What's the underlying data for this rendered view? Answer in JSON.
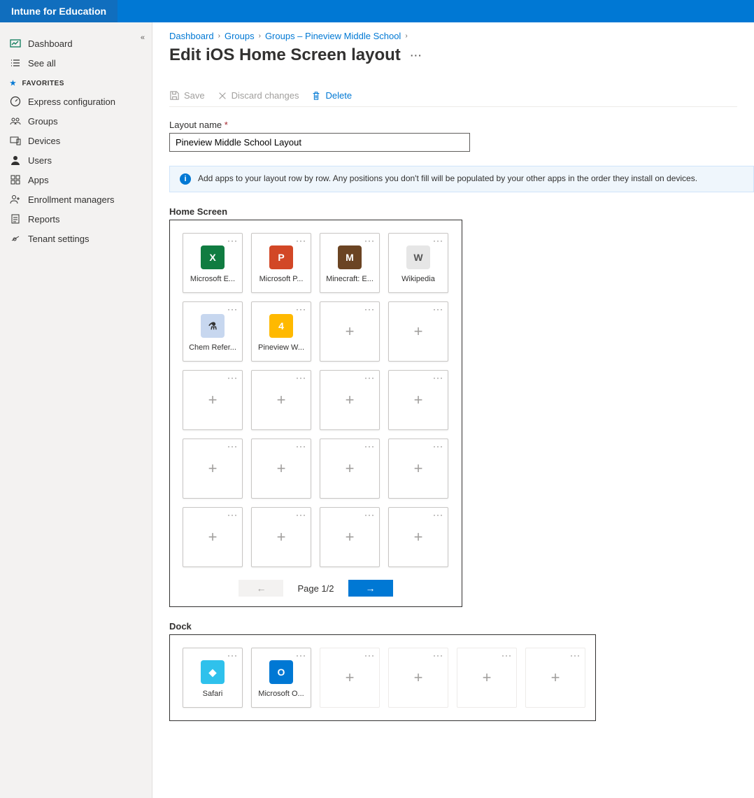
{
  "header": {
    "brand": "Intune for Education"
  },
  "sidebar": {
    "top": [
      {
        "label": "Dashboard",
        "icon": "dashboard-icon"
      },
      {
        "label": "See all",
        "icon": "list-icon"
      }
    ],
    "favorites_header": "FAVORITES",
    "favorites": [
      {
        "label": "Express configuration",
        "icon": "gauge-icon"
      },
      {
        "label": "Groups",
        "icon": "groups-icon"
      },
      {
        "label": "Devices",
        "icon": "devices-icon"
      },
      {
        "label": "Users",
        "icon": "user-icon"
      },
      {
        "label": "Apps",
        "icon": "apps-icon"
      },
      {
        "label": "Enrollment managers",
        "icon": "enrollment-icon"
      },
      {
        "label": "Reports",
        "icon": "reports-icon"
      },
      {
        "label": "Tenant settings",
        "icon": "settings-icon"
      }
    ]
  },
  "breadcrumbs": {
    "items": [
      "Dashboard",
      "Groups",
      "Groups – Pineview Middle School"
    ]
  },
  "page_title": "Edit iOS Home Screen layout",
  "toolbar": {
    "save_label": "Save",
    "discard_label": "Discard changes",
    "delete_label": "Delete"
  },
  "form": {
    "layout_name_label": "Layout name",
    "layout_name_value": "Pineview Middle School Layout"
  },
  "info_banner": "Add apps to your layout row by row. Any positions you don't fill will be populated by your other apps in the order they install on devices.",
  "sections": {
    "home_screen_label": "Home Screen",
    "dock_label": "Dock"
  },
  "home_screen": {
    "rows": 5,
    "cols": 4,
    "tiles": [
      {
        "label": "Microsoft E...",
        "full": "Microsoft Excel",
        "bg": "#107c41",
        "letter": "X"
      },
      {
        "label": "Microsoft P...",
        "full": "Microsoft PowerPoint",
        "bg": "#d24726",
        "letter": "P"
      },
      {
        "label": "Minecraft: E...",
        "full": "Minecraft: Education Edition",
        "bg": "#6b4423",
        "letter": "M"
      },
      {
        "label": "Wikipedia",
        "full": "Wikipedia",
        "bg": "#e6e6e6",
        "letter": "W",
        "fg": "#555"
      },
      {
        "label": "Chem Refer...",
        "full": "Chem Reference",
        "bg": "#c7d7ef",
        "letter": "⚗",
        "fg": "#333"
      },
      {
        "label": "Pineview W...",
        "full": "Pineview Work (folder)",
        "bg": "#ffb900",
        "letter": "4",
        "folder": true
      }
    ],
    "page_label": "Page 1/2"
  },
  "dock": {
    "slots": 6,
    "tiles": [
      {
        "label": "Safari",
        "bg": "#2fc1ec",
        "letter": "◆"
      },
      {
        "label": "Microsoft O...",
        "full": "Microsoft Outlook",
        "bg": "#0078d4",
        "letter": "O"
      }
    ]
  }
}
